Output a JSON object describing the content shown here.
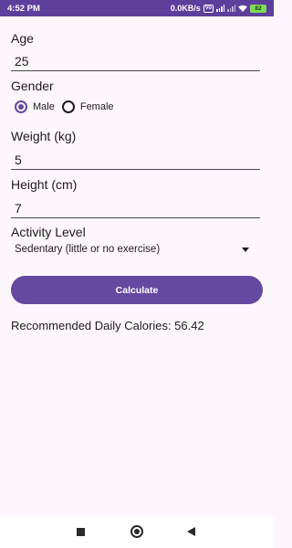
{
  "status_bar": {
    "time": "4:52 PM",
    "net_speed": "0.0KB/s",
    "volte": "Vo",
    "battery": "82"
  },
  "form": {
    "age_label": "Age",
    "age_value": "25",
    "gender_label": "Gender",
    "gender_options": [
      {
        "label": "Male",
        "selected": true
      },
      {
        "label": "Female",
        "selected": false
      }
    ],
    "weight_label": "Weight (kg)",
    "weight_value": "5",
    "height_label": "Height (cm)",
    "height_value": "7",
    "activity_label": "Activity Level",
    "activity_selected": "Sedentary (little or no exercise)",
    "calculate_label": "Calculate"
  },
  "result": {
    "text": "Recommended Daily Calories: 56.42"
  },
  "colors": {
    "status_bar": "#5d3e9b",
    "accent": "#65489f",
    "background": "#fdf7fd"
  },
  "icons": [
    "wifi-icon",
    "signal-icon",
    "battery-icon",
    "dropdown-arrow-icon",
    "nav-recents-icon",
    "nav-home-icon",
    "nav-back-icon"
  ]
}
